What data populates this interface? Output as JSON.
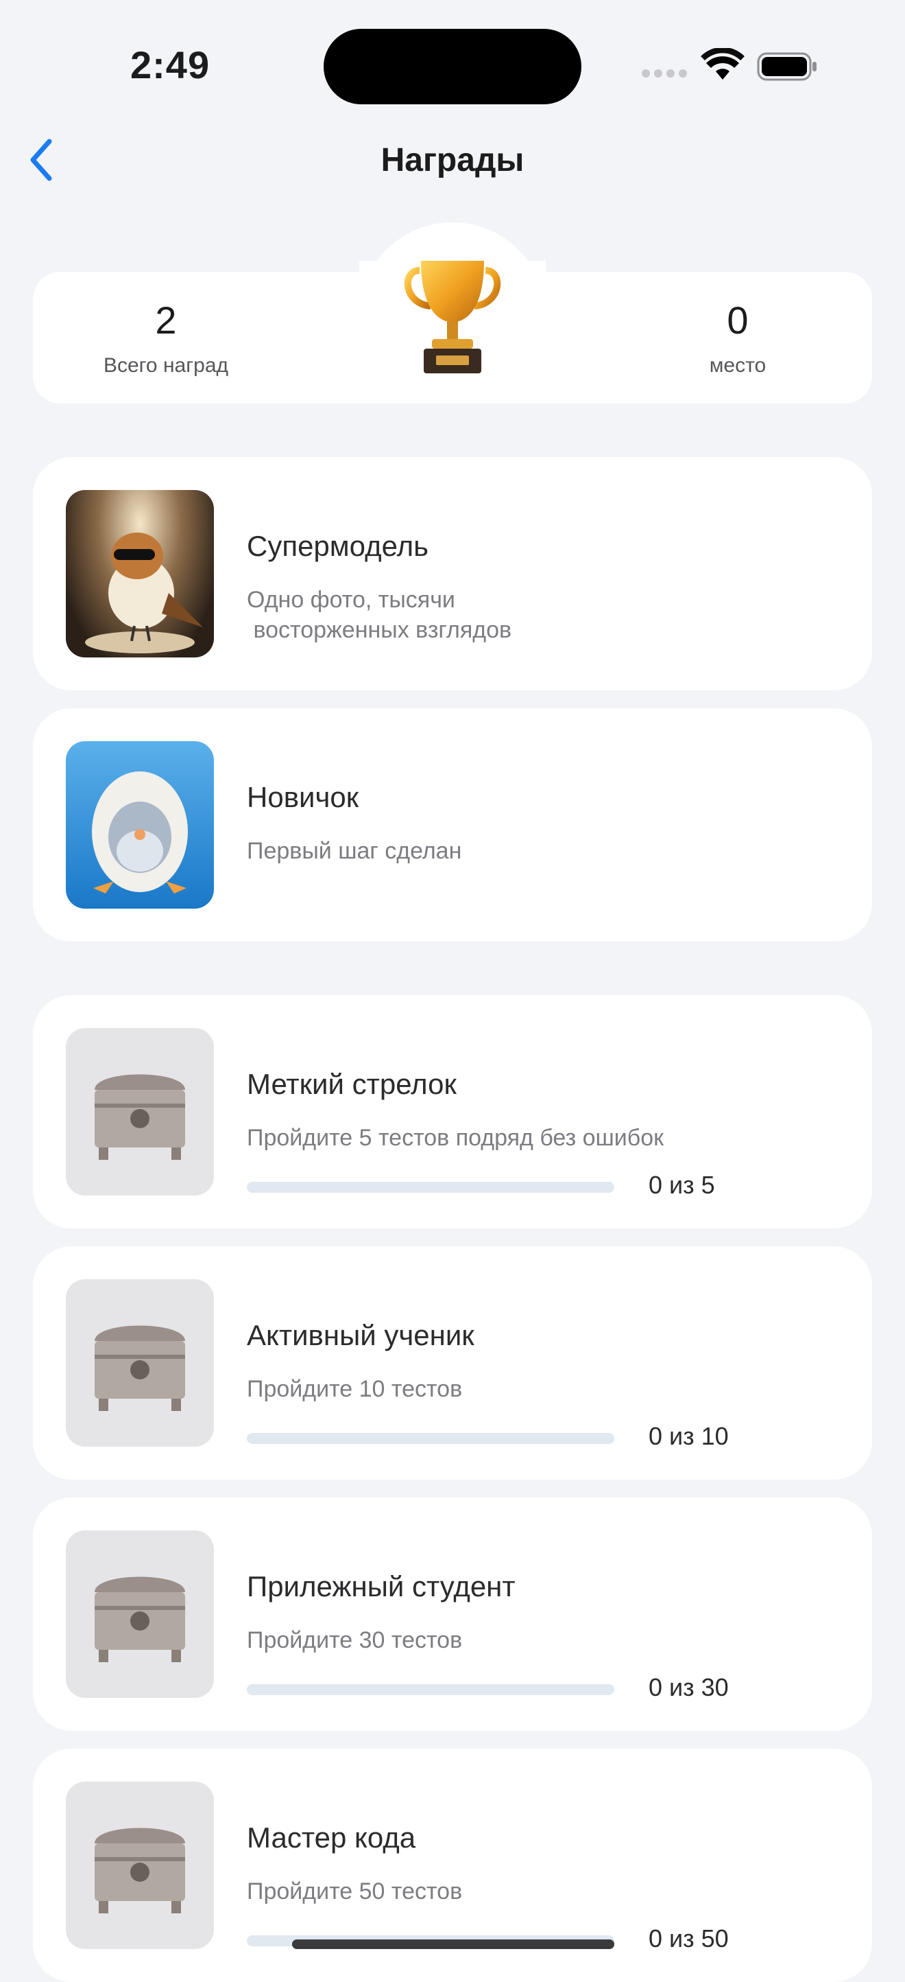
{
  "status": {
    "time": "2:49"
  },
  "header": {
    "title": "Награды"
  },
  "summary": {
    "total_value": "2",
    "total_label": "Всего наград",
    "place_value": "0",
    "place_label": "место"
  },
  "earned": [
    {
      "title": "Супермодель",
      "desc": "Одно фото, тысячи\n восторженных взглядов"
    },
    {
      "title": "Новичок",
      "desc": "Первый шаг сделан"
    }
  ],
  "locked": [
    {
      "title": "Меткий стрелок",
      "desc": "Пройдите 5 тестов подряд без ошибок",
      "progress": "0 из 5",
      "fraction": 0
    },
    {
      "title": "Активный ученик",
      "desc": "Пройдите 10 тестов",
      "progress": "0 из 10",
      "fraction": 0
    },
    {
      "title": "Прилежный студент",
      "desc": "Пройдите 30 тестов",
      "progress": "0 из 30",
      "fraction": 0
    },
    {
      "title": "Мастер кода",
      "desc": "Пройдите 50 тестов",
      "progress": "0 из 50",
      "fraction": 0
    }
  ],
  "icons": {
    "back": "chevron-left-icon",
    "award": "trophy-icon",
    "locked": "treasure-chest-icon"
  },
  "colors": {
    "accent": "#1a7cf2",
    "background": "#f3f4f8",
    "card": "#ffffff"
  }
}
